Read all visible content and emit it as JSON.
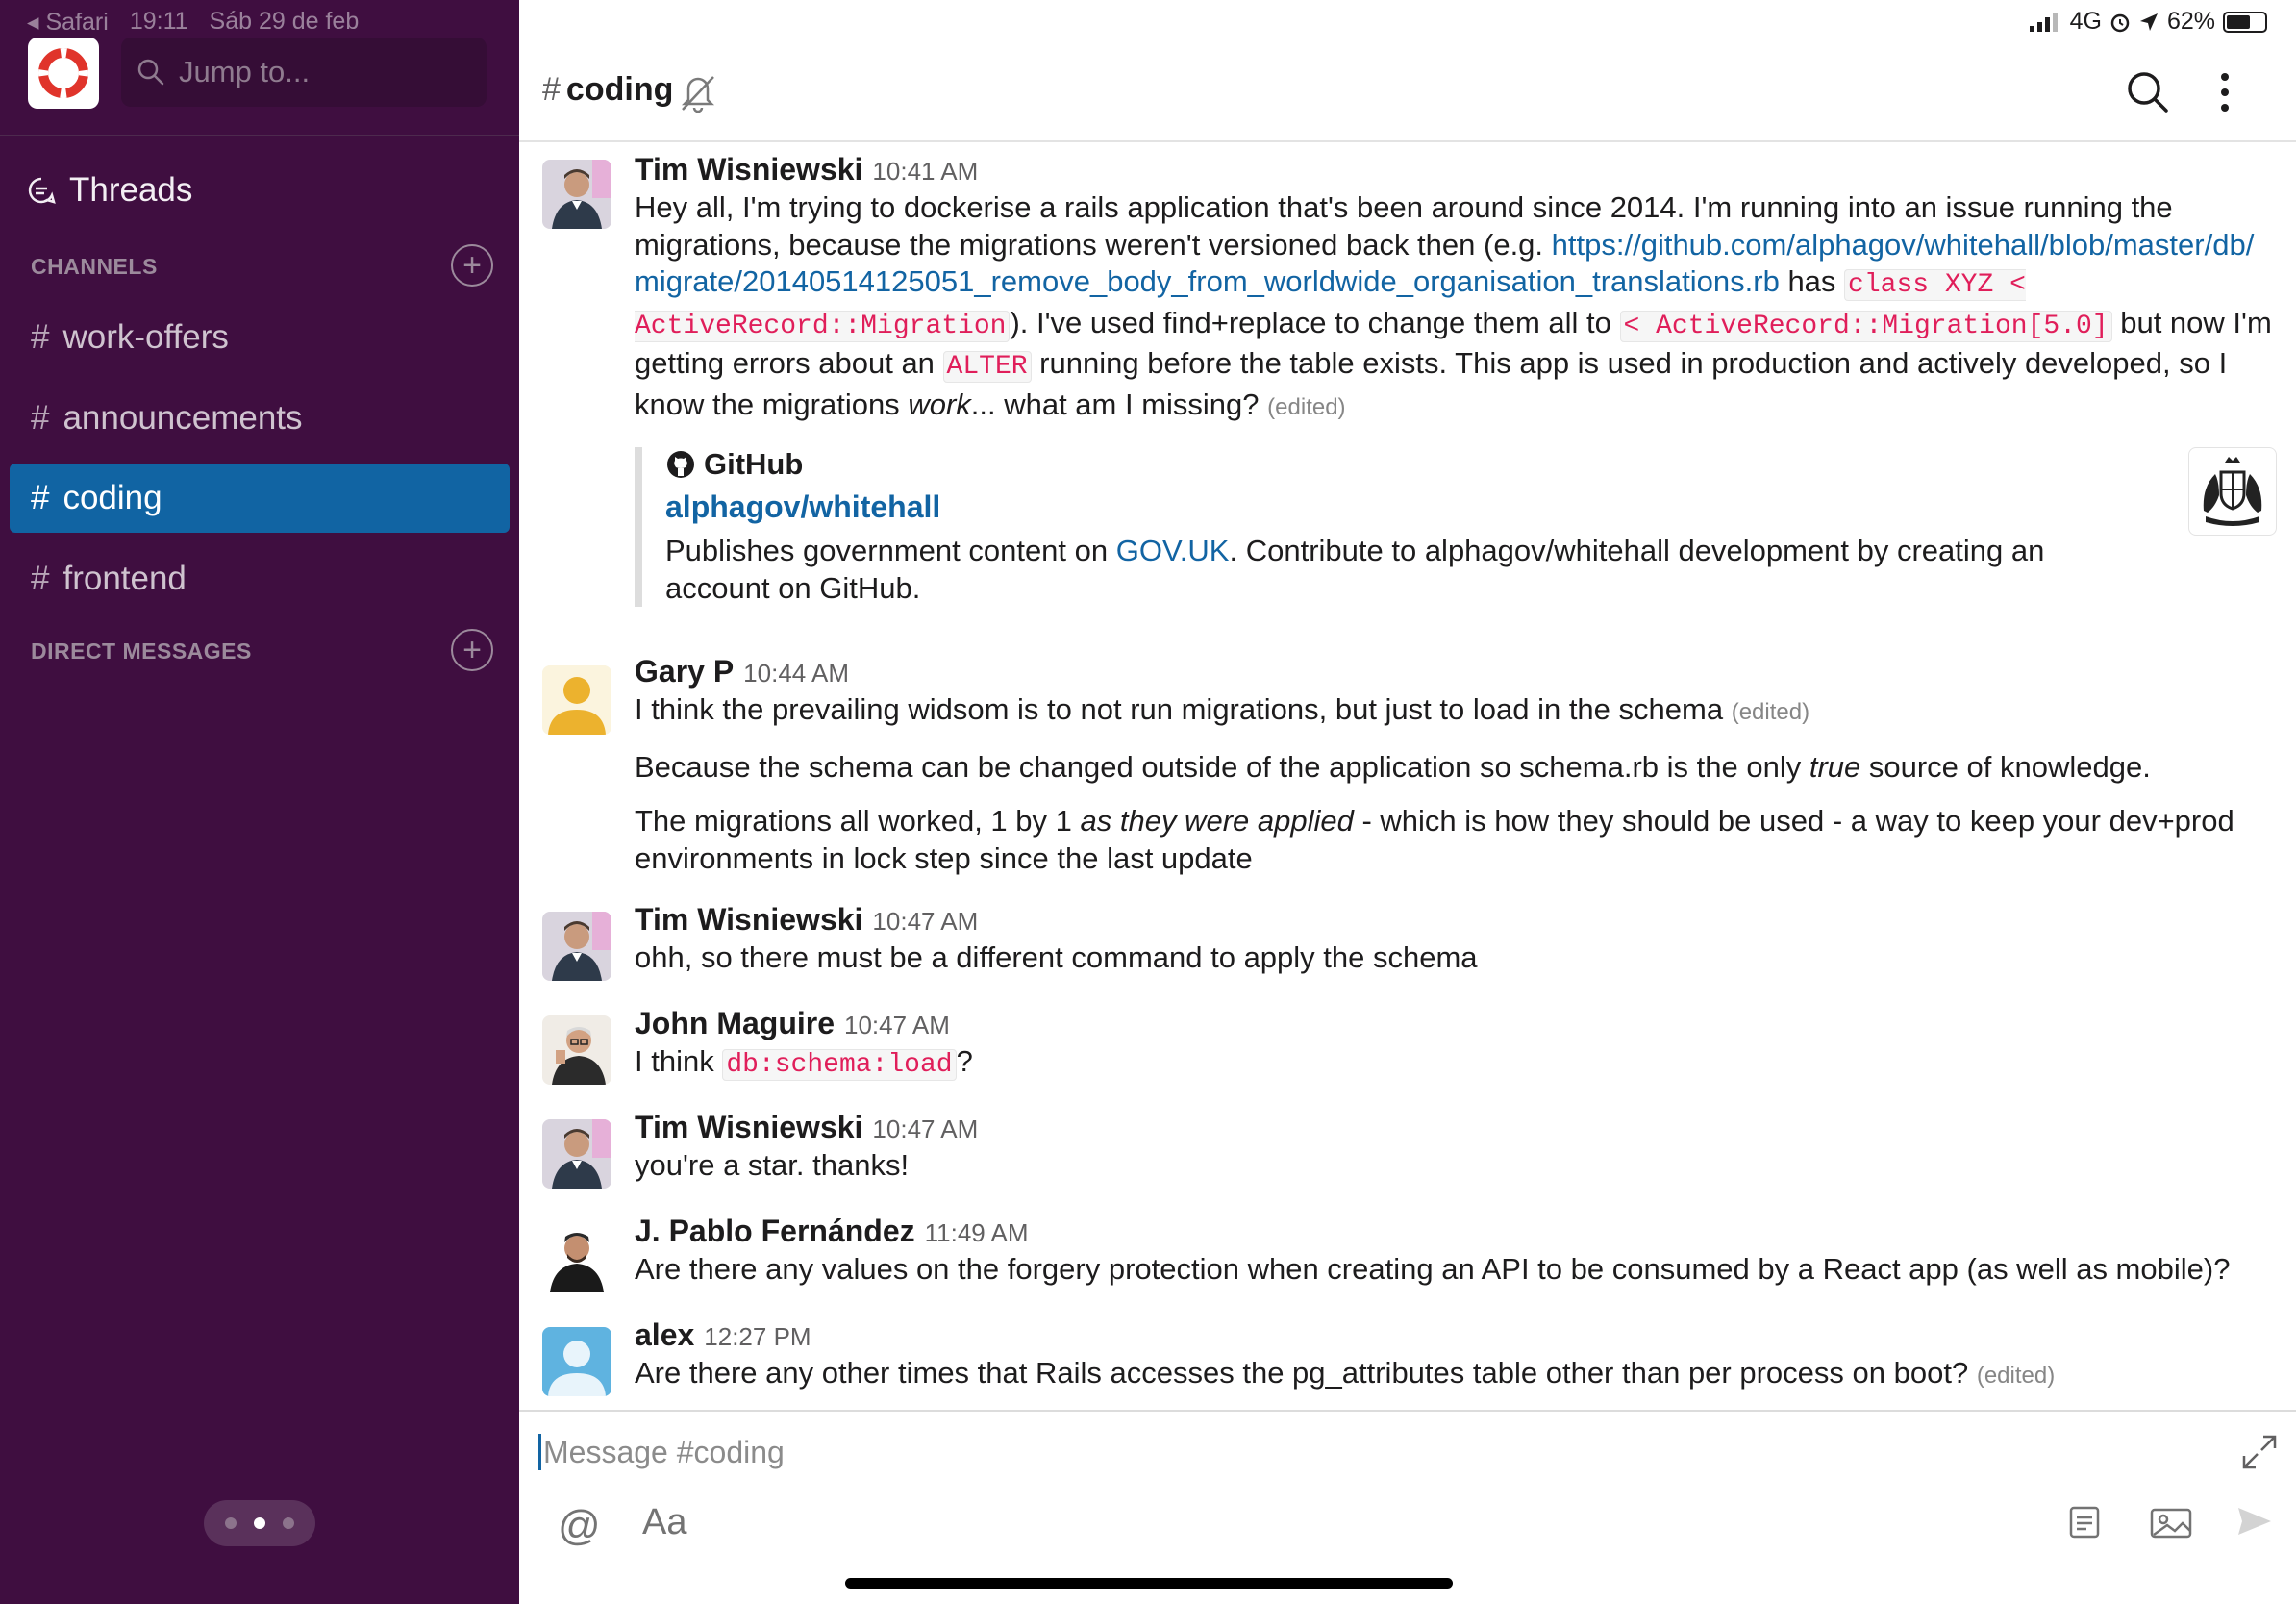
{
  "statusbar": {
    "left": [
      "◂ Safari",
      "19:11",
      "Sáb 29 de feb"
    ],
    "network": "4G",
    "battery": "62%"
  },
  "sidebar": {
    "search_placeholder": "Jump to...",
    "threads_label": "Threads",
    "channels_header": "CHANNELS",
    "channels": [
      {
        "name": "work-offers",
        "active": false
      },
      {
        "name": "announcements",
        "active": false
      },
      {
        "name": "coding",
        "active": true
      },
      {
        "name": "frontend",
        "active": false
      }
    ],
    "dm_header": "DIRECT MESSAGES",
    "hash": "#"
  },
  "header": {
    "hash": "#",
    "channel": "coding"
  },
  "messages": [
    {
      "author": "Tim Wisniewski",
      "time": "10:41 AM",
      "parts": {
        "t1": "Hey all, I'm trying to dockerise a rails application that's been around since 2014. I'm running into an issue running the migrations, because the migrations weren't versioned back then (e.g. ",
        "link": "https://github.com/alphagov/whitehall/blob/master/db/migrate/20140514125051_remove_body_from_worldwide_organisation_translations.rb",
        "t2": " has ",
        "code1": "class XYZ < ActiveRecord::Migration",
        "t3": "). I've used find+replace to change them all to ",
        "code2": "< ActiveRecord::Migration[5.0]",
        "t4": " but now I'm getting errors about an ",
        "code3": "ALTER",
        "t5": " running before the table exists. This app is used in production and actively developed, so I know the migrations ",
        "em": "work",
        "t6": "... what am I missing?",
        "edited": "(edited)"
      },
      "attachment": {
        "service": "GitHub",
        "title": "alphagov/whitehall",
        "desc_1": "Publishes government content on ",
        "desc_link": "GOV.UK",
        "desc_2": ". Contribute to alphagov/whitehall development by creating an account on GitHub."
      }
    },
    {
      "author": "Gary P",
      "time": "10:44 AM",
      "p1": "I think the prevailing widsom is to not run migrations, but just to load in the schema",
      "p1_edited": "(edited)",
      "p2a": "Because the schema can be changed outside of the application so schema.rb is the only ",
      "p2em": "true",
      "p2b": " source of knowledge.",
      "p3a": "The migrations all worked, 1 by 1 ",
      "p3em": "as they were applied",
      "p3b": " - which is how they should be used - a way to keep your dev+prod environments in lock step since the last update"
    },
    {
      "author": "Tim Wisniewski",
      "time": "10:47 AM",
      "text": "ohh, so there must be a different command to apply the schema"
    },
    {
      "author": "John Maguire",
      "time": "10:47 AM",
      "t1": "I think ",
      "code": "db:schema:load",
      "t2": "?"
    },
    {
      "author": "Tim Wisniewski",
      "time": "10:47 AM",
      "text": "you're a star. thanks!"
    },
    {
      "author": "J. Pablo Fernández",
      "time": "11:49 AM",
      "text": "Are there any values on the forgery protection when creating an API to be consumed by a React app (as well as mobile)?"
    },
    {
      "author": "alex",
      "time": "12:27 PM",
      "text": "Are there any other times that Rails accesses the pg_attributes table other than per process on boot?",
      "edited": "(edited)"
    }
  ],
  "composer": {
    "placeholder": "Message #coding",
    "at": "@",
    "format": "Aa"
  },
  "colors": {
    "sidebar_bg": "#3f0e40",
    "active_channel": "#1164a3",
    "link": "#1264a3",
    "code": "#e01e5a"
  }
}
